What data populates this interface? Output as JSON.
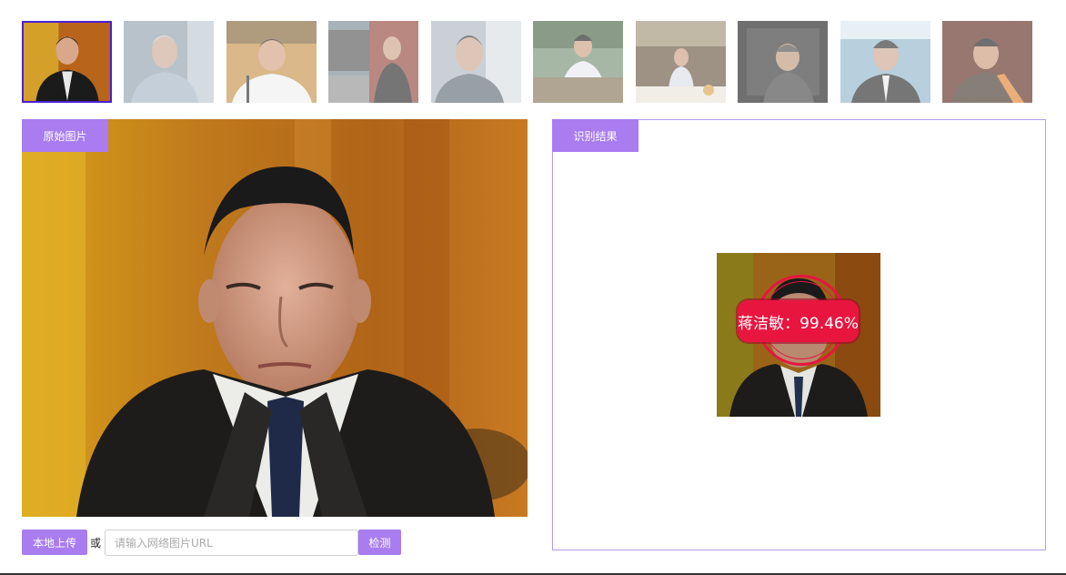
{
  "thumbnails": [
    {
      "id": "thumb-1",
      "selected": true
    },
    {
      "id": "thumb-2",
      "selected": false
    },
    {
      "id": "thumb-3",
      "selected": false
    },
    {
      "id": "thumb-4",
      "selected": false
    },
    {
      "id": "thumb-5",
      "selected": false
    },
    {
      "id": "thumb-6",
      "selected": false
    },
    {
      "id": "thumb-7",
      "selected": false
    },
    {
      "id": "thumb-8",
      "selected": false
    },
    {
      "id": "thumb-9",
      "selected": false
    },
    {
      "id": "thumb-10",
      "selected": false
    }
  ],
  "original": {
    "tag_label": "原始图片"
  },
  "upload": {
    "local_upload_label": "本地上传",
    "or_text": "或",
    "url_placeholder": "请输入网络图片URL",
    "url_value": "",
    "detect_label": "检测"
  },
  "result": {
    "tag_label": "识别结果",
    "match_label": "蒋洁敏：99.46%"
  },
  "colors": {
    "accent": "#a97cf0",
    "selected_border": "#4b1fd6",
    "match_red": "#e8153f",
    "panel_border": "#b49cf0"
  }
}
